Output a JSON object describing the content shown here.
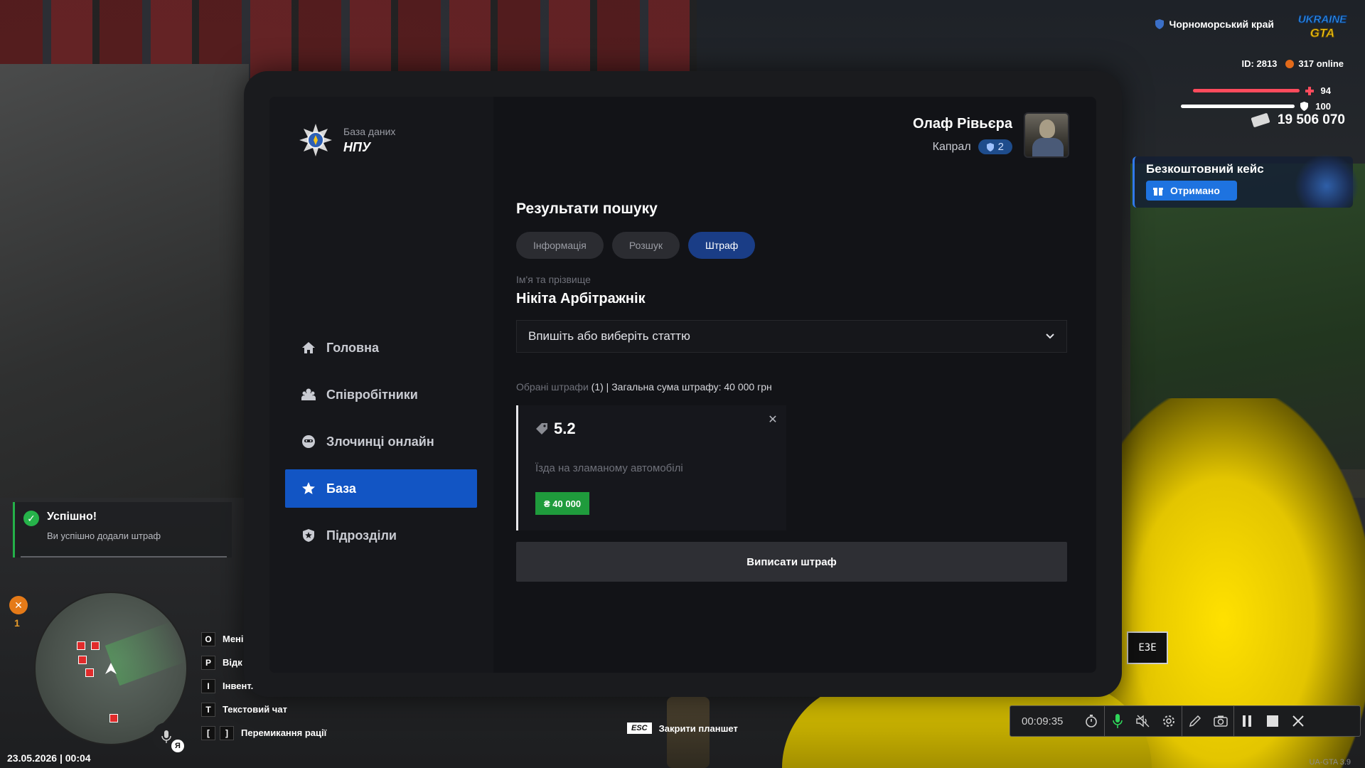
{
  "hud": {
    "region": "Чорноморський край",
    "game_logo_line1": "UKRAINE",
    "game_logo_line2": "GTA",
    "player_id": "ID: 2813",
    "online": "317 online",
    "health": "94",
    "health_level": 0.94,
    "armor": "100",
    "armor_level": 1.0,
    "money": "19 506 070",
    "colors": {
      "health": "#ff4b5c",
      "armor": "#ffffff",
      "accent": "#1255c4",
      "success": "#1f9b3c"
    }
  },
  "promo": {
    "title": "Безкоштовний кейс",
    "button_label": "Отримано"
  },
  "toast": {
    "title": "Успішно!",
    "text": "Ви успішно додали штраф"
  },
  "tablet": {
    "logo": {
      "subtitle": "База даних",
      "title": "НПУ"
    },
    "user": {
      "name": "Олаф Рівьєра",
      "rank": "Капрал",
      "rank_level": "2"
    },
    "nav": [
      {
        "label": "Головна",
        "icon": "home-icon"
      },
      {
        "label": "Співробітники",
        "icon": "users-icon"
      },
      {
        "label": "Злочинці онлайн",
        "icon": "mask-icon"
      },
      {
        "label": "База",
        "icon": "star-icon",
        "active": true
      },
      {
        "label": "Підрозділи",
        "icon": "shield-star-icon"
      }
    ],
    "main": {
      "heading": "Результати пошуку",
      "tabs": [
        {
          "label": "Інформація"
        },
        {
          "label": "Розшук"
        },
        {
          "label": "Штраф",
          "active": true
        }
      ],
      "name_label": "Ім'я та прізвище",
      "person_name": "Нікіта Арбітражнік",
      "article_select": {
        "value": "Впишіть або виберіть статтю"
      },
      "summary_muted": "Обрані штрафи",
      "summary_rest": "(1) | Загальна сума штрафу: 40 000 грн",
      "fines": [
        {
          "code": "5.2",
          "description": "Їзда на зламаному автомобілі",
          "amount": "₴ 40 000"
        }
      ],
      "submit_label": "Виписати штраф"
    }
  },
  "minimap": {
    "marker_count": "1",
    "voice_badge": "Я",
    "datetime": "23.05.2026 | 00:04"
  },
  "keybinds": [
    {
      "keys": [
        "O"
      ],
      "label": "Мені"
    },
    {
      "keys": [
        "P"
      ],
      "label": "Відк"
    },
    {
      "keys": [
        "I"
      ],
      "label": "Інвент."
    },
    {
      "keys": [
        "T"
      ],
      "label": "Текстовий чат"
    },
    {
      "keys": [
        "[",
        "]"
      ],
      "label": "Перемикання рації"
    }
  ],
  "esc_hint": {
    "key": "ESC",
    "label": "Закрити планшет"
  },
  "recorder": {
    "time": "00:09:35"
  },
  "version": "UA-GTA 3.9",
  "scenery": {
    "plate_text": "ЕЗЕ"
  }
}
